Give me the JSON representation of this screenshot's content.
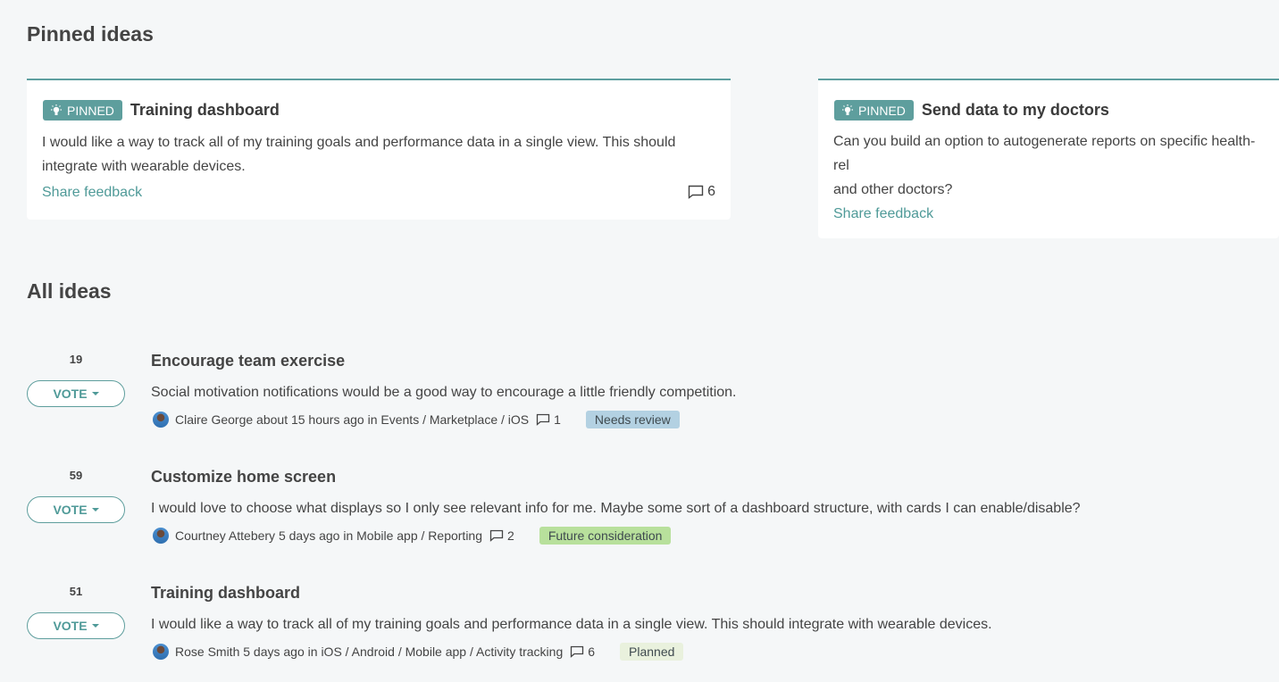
{
  "pinned_section": {
    "title": "Pinned ideas",
    "badge_label": "PINNED",
    "cards": [
      {
        "title": "Training dashboard",
        "desc_line1": "I would like a way to track all of my training goals and performance data in a single view. This should",
        "desc_line2": "integrate with wearable devices.",
        "share_label": "Share feedback",
        "comments": "6"
      },
      {
        "title": "Send data to my doctors",
        "desc_line1": "Can you build an option to autogenerate reports on specific health-rel",
        "desc_line2": "and other doctors?",
        "share_label": "Share feedback"
      }
    ]
  },
  "all_section": {
    "title": "All ideas",
    "vote_label": "VOTE",
    "ideas": [
      {
        "votes": "19",
        "title": "Encourage team exercise",
        "desc": "Social motivation notifications would be a good way to encourage a little friendly competition.",
        "author": "Claire George",
        "time": "about 15 hours ago in",
        "categories": "Events / Marketplace / iOS",
        "comments": "1",
        "status": "Needs review",
        "status_color": "#b3d1e2"
      },
      {
        "votes": "59",
        "title": "Customize home screen",
        "desc": "I would love to choose what displays so I only see relevant info for me. Maybe some sort of a dashboard structure, with cards I can enable/disable?",
        "author": "Courtney Attebery",
        "time": "5 days ago in",
        "categories": "Mobile app / Reporting",
        "comments": "2",
        "status": "Future consideration",
        "status_color": "#b8e09c"
      },
      {
        "votes": "51",
        "title": "Training dashboard",
        "desc": "I would like a way to track all of my training goals and performance data in a single view. This should integrate with wearable devices.",
        "author": "Rose Smith",
        "time": "5 days ago in",
        "categories": "iOS / Android / Mobile app / Activity tracking",
        "comments": "6",
        "status": "Planned",
        "status_color": "#e9f1dd"
      }
    ]
  },
  "colors": {
    "accent": "#5e9e9d",
    "background": "#f5f7f8"
  }
}
